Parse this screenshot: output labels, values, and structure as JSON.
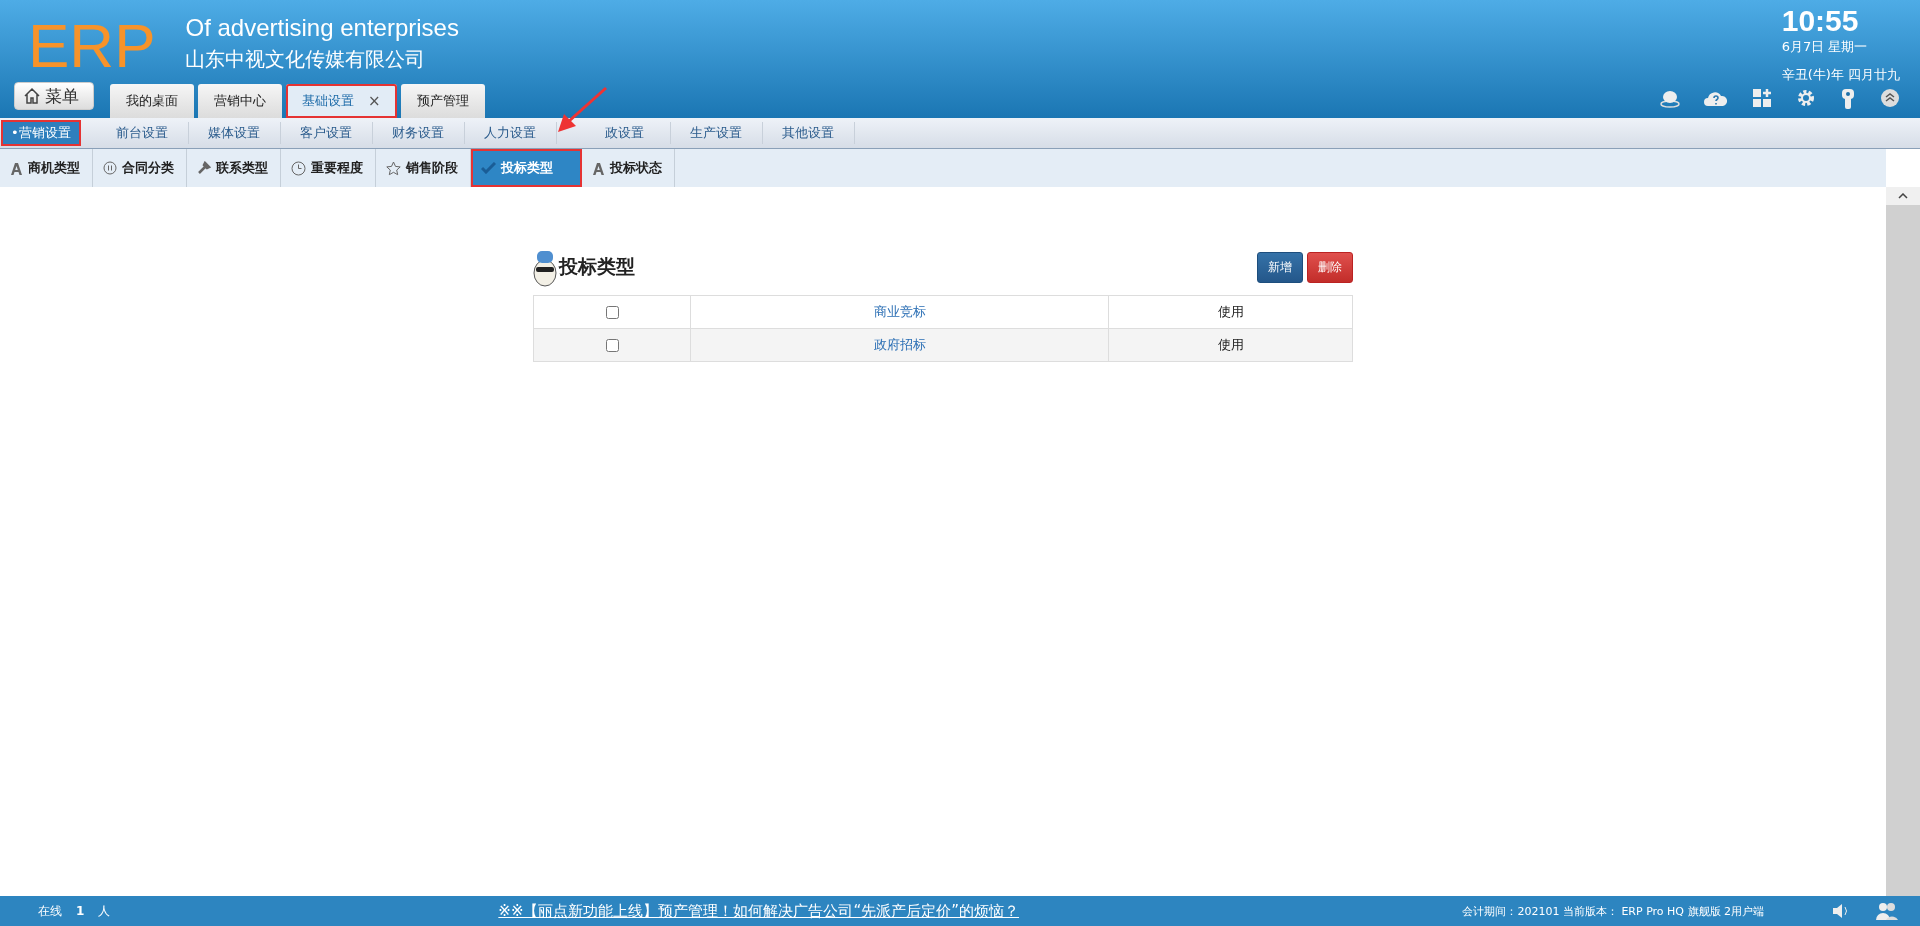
{
  "header": {
    "logo": "ERP",
    "subtitle": "Of advertising enterprises",
    "company": "山东中视文化传媒有限公司",
    "time": "10:55",
    "date": "6月7日 星期一",
    "lunar_date": "辛丑(牛)年 四月廿九",
    "menu_button": "菜单"
  },
  "tabs": [
    {
      "label": "我的桌面",
      "selected": false,
      "highlighted": false,
      "closable": false
    },
    {
      "label": "营销中心",
      "selected": false,
      "highlighted": false,
      "closable": false
    },
    {
      "label": "基础设置",
      "selected": true,
      "highlighted": true,
      "closable": true,
      "close": "×"
    },
    {
      "label": "预产管理",
      "selected": false,
      "highlighted": false,
      "closable": false
    }
  ],
  "nav": [
    {
      "label": "•营销设置",
      "selected": true,
      "highlighted": true
    },
    {
      "label": "前台设置",
      "selected": false,
      "highlighted": false
    },
    {
      "label": "媒体设置",
      "selected": false,
      "highlighted": false
    },
    {
      "label": "客户设置",
      "selected": false,
      "highlighted": false
    },
    {
      "label": "财务设置",
      "selected": false,
      "highlighted": false
    },
    {
      "label": "人力设置",
      "selected": false,
      "highlighted": false
    },
    {
      "label": "政设置",
      "selected": false,
      "highlighted": false,
      "arrow": true
    },
    {
      "label": "生产设置",
      "selected": false,
      "highlighted": false
    },
    {
      "label": "其他设置",
      "selected": false,
      "highlighted": false
    }
  ],
  "subtabs": [
    {
      "label": "商机类型",
      "kind": "letter",
      "selected": false,
      "highlighted": false
    },
    {
      "label": "合同分类",
      "kind": "pause",
      "selected": false,
      "highlighted": false
    },
    {
      "label": "联系类型",
      "kind": "wrench",
      "selected": false,
      "highlighted": false
    },
    {
      "label": "重要程度",
      "kind": "clock",
      "selected": false,
      "highlighted": false
    },
    {
      "label": "销售阶段",
      "kind": "star",
      "selected": false,
      "highlighted": false
    },
    {
      "label": "投标类型",
      "kind": "check",
      "selected": true,
      "highlighted": true
    },
    {
      "label": "投标状态",
      "kind": "letter",
      "selected": false,
      "highlighted": false
    }
  ],
  "panel": {
    "title": "投标类型",
    "buttons": [
      {
        "label": "新增",
        "kind": "primary"
      },
      {
        "label": "删除",
        "kind": "danger"
      }
    ],
    "rows": [
      {
        "checked": false,
        "name": "商业竞标",
        "status": "使用"
      },
      {
        "checked": false,
        "name": "政府招标",
        "status": "使用"
      }
    ]
  },
  "status_bar": {
    "online_label": "在线",
    "online_count": "1",
    "online_unit": "人",
    "news": "※※【丽点新功能上线】预产管理！如何解决广告公司“先派产后定价”的烦恼？",
    "info": "会计期间：202101 当前版本： ERP Pro HQ 旗舰版 2用户端"
  }
}
